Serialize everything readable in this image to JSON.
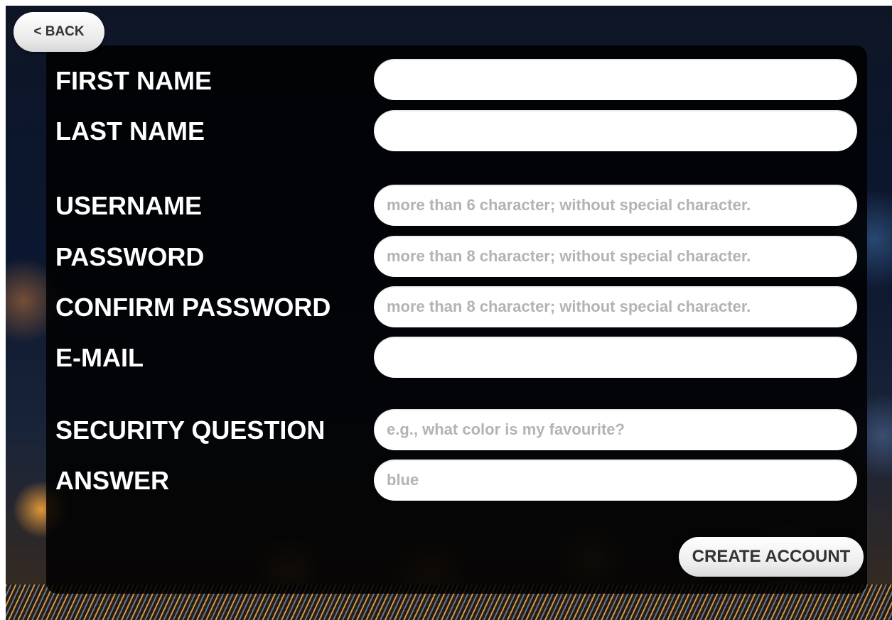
{
  "back_button": {
    "label": "< BACK"
  },
  "form": {
    "first_name": {
      "label": "FIRST NAME",
      "value": "",
      "placeholder": ""
    },
    "last_name": {
      "label": "LAST NAME",
      "value": "",
      "placeholder": ""
    },
    "username": {
      "label": "USERNAME",
      "value": "",
      "placeholder": "more than 6 character; without special character."
    },
    "password": {
      "label": "PASSWORD",
      "value": "",
      "placeholder": "more than 8 character; without special character."
    },
    "confirm_password": {
      "label": "CONFIRM PASSWORD",
      "value": "",
      "placeholder": "more than 8 character; without special character."
    },
    "email": {
      "label": "E-MAIL",
      "value": "",
      "placeholder": ""
    },
    "security_question": {
      "label": "SECURITY QUESTION",
      "value": "",
      "placeholder": "e.g., what color is my favourite?"
    },
    "answer": {
      "label": "ANSWER",
      "value": "",
      "placeholder": "blue"
    }
  },
  "create_button": {
    "label": "CREATE ACCOUNT"
  },
  "colors": {
    "panel": "#000000",
    "label_text": "#ffffff",
    "field_background": "#ffffff",
    "placeholder_text": "#b3b3b3"
  }
}
